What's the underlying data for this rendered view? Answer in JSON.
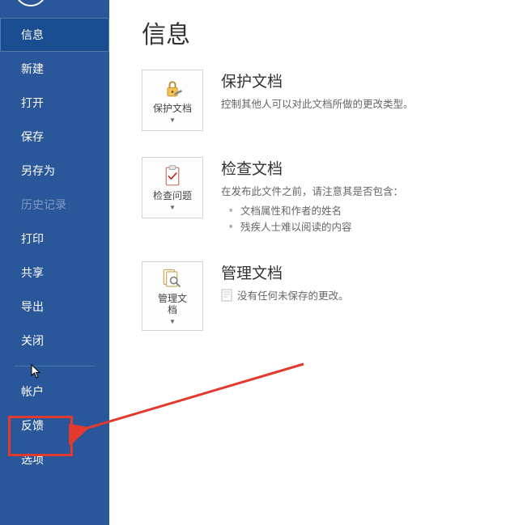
{
  "sidebar": {
    "items": [
      {
        "label": "信息",
        "key": "info",
        "selected": true
      },
      {
        "label": "新建",
        "key": "new"
      },
      {
        "label": "打开",
        "key": "open"
      },
      {
        "label": "保存",
        "key": "save"
      },
      {
        "label": "另存为",
        "key": "saveas"
      },
      {
        "label": "历史记录",
        "key": "history",
        "disabled": true
      },
      {
        "label": "打印",
        "key": "print"
      },
      {
        "label": "共享",
        "key": "share"
      },
      {
        "label": "导出",
        "key": "export"
      },
      {
        "label": "关闭",
        "key": "close"
      }
    ],
    "bottom_items": [
      {
        "label": "帐户",
        "key": "account"
      },
      {
        "label": "反馈",
        "key": "feedback"
      },
      {
        "label": "选项",
        "key": "options",
        "highlighted": true
      }
    ]
  },
  "page": {
    "title": "信息"
  },
  "sections": {
    "protect": {
      "button_label": "保护文档",
      "title": "保护文档",
      "desc": "控制其他人可以对此文档所做的更改类型。"
    },
    "inspect": {
      "button_label": "检查问题",
      "title": "检查文档",
      "lead": "在发布此文件之前，请注意其是否包含：",
      "bullets": [
        "文档属性和作者的姓名",
        "残疾人士难以阅读的内容"
      ]
    },
    "manage": {
      "button_label": "管理文\n档",
      "title": "管理文档",
      "desc": "没有任何未保存的更改。"
    }
  },
  "annotations": {
    "highlight_target": "选项",
    "arrow_color": "#e33a2f"
  }
}
